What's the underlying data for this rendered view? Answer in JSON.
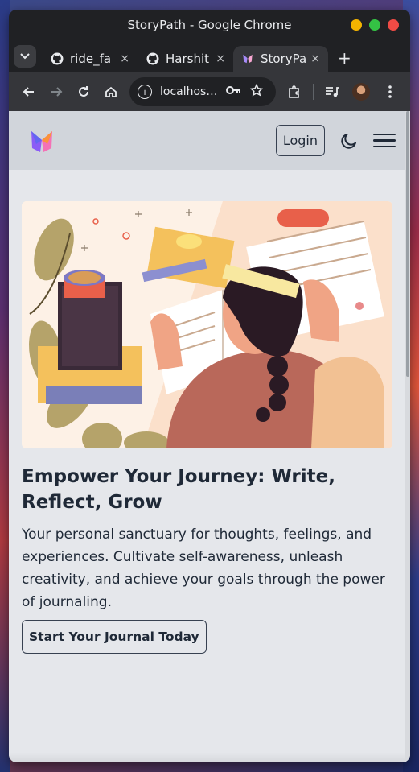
{
  "window": {
    "title": "StoryPath - Google Chrome"
  },
  "tabs": [
    {
      "label": "ride_fa",
      "icon": "github-icon",
      "close": "×"
    },
    {
      "label": "Harshit",
      "icon": "github-icon",
      "close": "×"
    },
    {
      "label": "StoryPa",
      "icon": "storypath-favicon-icon",
      "close": "×",
      "active": true
    }
  ],
  "toolbar": {
    "url": "localhos…"
  },
  "site": {
    "nav": {
      "login_label": "Login"
    },
    "hero": {
      "headline": "Empower Your Journey: Write, Reflect, Grow",
      "subtext": "Your personal sanctuary for thoughts, feelings, and experiences. Cultivate self-awareness, unleash creativity, and achieve your goals through the power of journaling.",
      "cta_label": "Start Your Journal Today"
    }
  },
  "colors": {
    "nav_bg": "#d1d5db",
    "page_bg": "#e5e7eb",
    "text": "#1f2937"
  }
}
